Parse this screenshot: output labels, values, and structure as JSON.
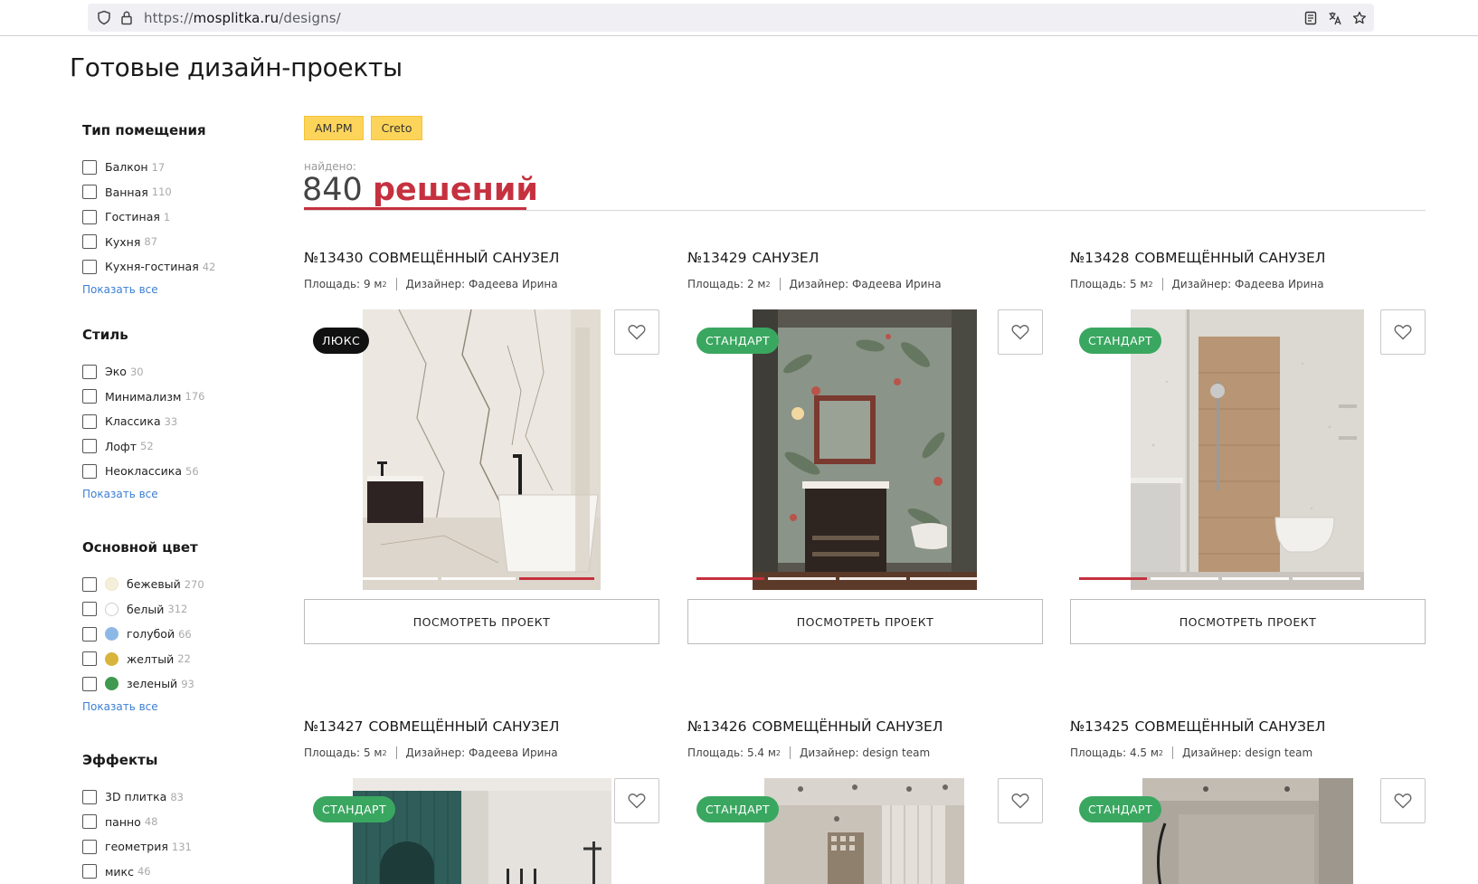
{
  "browser": {
    "url_prefix": "https://",
    "url_host": "mosplitka.ru",
    "url_path": "/designs/"
  },
  "page": {
    "title": "Готовые дизайн-проекты"
  },
  "sidebar": {
    "groups": [
      {
        "title": "Тип помещения",
        "items": [
          {
            "label": "Балкон",
            "count": "17"
          },
          {
            "label": "Ванная",
            "count": "110"
          },
          {
            "label": "Гостиная",
            "count": "1"
          },
          {
            "label": "Кухня",
            "count": "87"
          },
          {
            "label": "Кухня-гостиная",
            "count": "42"
          }
        ],
        "show_all": "Показать все"
      },
      {
        "title": "Стиль",
        "items": [
          {
            "label": "Эко",
            "count": "30"
          },
          {
            "label": "Минимализм",
            "count": "176"
          },
          {
            "label": "Классика",
            "count": "33"
          },
          {
            "label": "Лофт",
            "count": "52"
          },
          {
            "label": "Неоклассика",
            "count": "56"
          }
        ],
        "show_all": "Показать все"
      },
      {
        "title": "Основной цвет",
        "items": [
          {
            "label": "бежевый",
            "count": "270",
            "color": "#f4efd9"
          },
          {
            "label": "белый",
            "count": "312",
            "color": "#ffffff"
          },
          {
            "label": "голубой",
            "count": "66",
            "color": "#8db8e6"
          },
          {
            "label": "желтый",
            "count": "22",
            "color": "#d9b43a"
          },
          {
            "label": "зеленый",
            "count": "93",
            "color": "#3f9a4f"
          }
        ],
        "show_all": "Показать все"
      },
      {
        "title": "Эффекты",
        "items": [
          {
            "label": "3D плитка",
            "count": "83"
          },
          {
            "label": "панно",
            "count": "48"
          },
          {
            "label": "геометрия",
            "count": "131"
          },
          {
            "label": "микс",
            "count": "46"
          }
        ]
      }
    ]
  },
  "tags": [
    "AM.PM",
    "Creto"
  ],
  "results": {
    "found_label": "найдено:",
    "count": "840",
    "word": "решений"
  },
  "colors": {
    "accent_red": "#c6313f",
    "badge_green": "#3aa760",
    "badge_black": "#111111",
    "tag_yellow": "#fcd45a",
    "link_blue": "#3d7fd3"
  },
  "cards": [
    {
      "number": "№13430",
      "type": "СОВМЕЩЁННЫЙ САНУЗЕЛ",
      "area_label": "Площадь:",
      "area": "9 м",
      "sup": "2",
      "designer_label": "Дизайнер:",
      "designer": "Фадеева Ирина",
      "badge": "ЛЮКС",
      "button": "ПОСМОТРЕТЬ ПРОЕКТ",
      "slide_active": 3,
      "slides": 4
    },
    {
      "number": "№13429",
      "type": "САНУЗЕЛ",
      "area_label": "Площадь:",
      "area": "2 м",
      "sup": "2",
      "designer_label": "Дизайнер:",
      "designer": "Фадеева Ирина",
      "badge": "СТАНДАРТ",
      "button": "ПОСМОТРЕТЬ ПРОЕКТ",
      "slide_active": 0,
      "slides": 4
    },
    {
      "number": "№13428",
      "type": "СОВМЕЩЁННЫЙ САНУЗЕЛ",
      "area_label": "Площадь:",
      "area": "5 м",
      "sup": "2",
      "designer_label": "Дизайнер:",
      "designer": "Фадеева Ирина",
      "badge": "СТАНДАРТ",
      "button": "ПОСМОТРЕТЬ ПРОЕКТ",
      "slide_active": 0,
      "slides": 4
    },
    {
      "number": "№13427",
      "type": "СОВМЕЩЁННЫЙ САНУЗЕЛ",
      "area_label": "Площадь:",
      "area": "5 м",
      "sup": "2",
      "designer_label": "Дизайнер:",
      "designer": "Фадеева Ирина",
      "badge": "СТАНДАРТ",
      "button": "ПОСМОТРЕТЬ ПРОЕКТ"
    },
    {
      "number": "№13426",
      "type": "СОВМЕЩЁННЫЙ САНУЗЕЛ",
      "area_label": "Площадь:",
      "area": "5.4 м",
      "sup": "2",
      "designer_label": "Дизайнер:",
      "designer": "design team",
      "badge": "СТАНДАРТ",
      "button": "ПОСМОТРЕТЬ ПРОЕКТ"
    },
    {
      "number": "№13425",
      "type": "СОВМЕЩЁННЫЙ САНУЗЕЛ",
      "area_label": "Площадь:",
      "area": "4.5 м",
      "sup": "2",
      "designer_label": "Дизайнер:",
      "designer": "design team",
      "badge": "СТАНДАРТ",
      "button": "ПОСМОТРЕТЬ ПРОЕКТ"
    }
  ]
}
